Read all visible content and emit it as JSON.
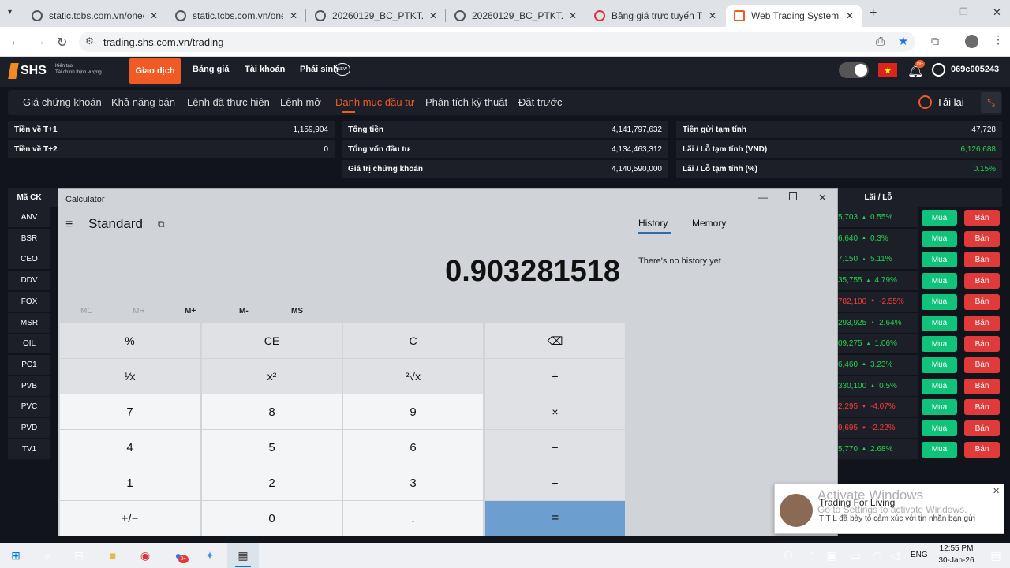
{
  "browser": {
    "tabs": [
      {
        "title": "static.tcbs.com.vn/oneclick"
      },
      {
        "title": "static.tcbs.com.vn/oneclick"
      },
      {
        "title": "20260129_BC_PTKT.pdf"
      },
      {
        "title": "20260129_BC_PTKT.pdf"
      },
      {
        "title": "Bảng giá trực tuyến TVSI"
      },
      {
        "title": "Web Trading System"
      }
    ],
    "url": "trading.shs.com.vn/trading"
  },
  "app": {
    "logo": "SHS",
    "logo_tagline_1": "Kiến tạo",
    "logo_tagline_2": "Tài chính thịnh vượng",
    "nav": [
      "Giao dịch",
      "Bảng giá",
      "Tài khoản",
      "Phái sinh"
    ],
    "new_badge": "NEW",
    "bell_badge": "99+",
    "username": "069c005243",
    "subnav": [
      "Giá chứng khoán",
      "Khả năng bán",
      "Lệnh đã thực hiện",
      "Lệnh mở",
      "Danh mục đầu tư",
      "Phân tích kỹ thuật",
      "Đặt trước"
    ],
    "reload_label": "Tải lại",
    "accent": "#f05a24"
  },
  "summary": {
    "col1": [
      {
        "label": "Tiền về T+1",
        "value": "1,159,904"
      },
      {
        "label": "Tiền về T+2",
        "value": "0"
      }
    ],
    "col2": [
      {
        "label": "Tổng tiền",
        "value": "4,141,797,632"
      },
      {
        "label": "Tổng vốn đầu tư",
        "value": "4,134,463,312"
      },
      {
        "label": "Giá trị chứng khoán",
        "value": "4,140,590,000"
      }
    ],
    "col3": [
      {
        "label": "Tiền gửi tạm tính",
        "value": "47,728"
      },
      {
        "label": "Lãi / Lỗ tạm tính (VND)",
        "value": "6,126,688"
      },
      {
        "label": "Lãi / Lỗ tạm tính (%)",
        "value": "0.15%"
      }
    ]
  },
  "table": {
    "header_code": "Mã CK",
    "header_pl": "Lãi / Lỗ",
    "buy_label": "Mua",
    "sell_label": "Bán",
    "rows": [
      {
        "code": "ANV",
        "pl": "5,703",
        "pct": "0.55%",
        "dir": "up"
      },
      {
        "code": "BSR",
        "pl": "6,640",
        "pct": "0.3%",
        "dir": "up"
      },
      {
        "code": "CEO",
        "pl": "7,150",
        "pct": "5.11%",
        "dir": "up"
      },
      {
        "code": "DDV",
        "pl": "35,755",
        "pct": "4.79%",
        "dir": "up"
      },
      {
        "code": "FOX",
        "pl": "782,100",
        "pct": "-2.55%",
        "dir": "down"
      },
      {
        "code": "MSR",
        "pl": "293,925",
        "pct": "2.64%",
        "dir": "up"
      },
      {
        "code": "OIL",
        "pl": "09,275",
        "pct": "1.06%",
        "dir": "up"
      },
      {
        "code": "PC1",
        "pl": "6,460",
        "pct": "3.23%",
        "dir": "up"
      },
      {
        "code": "PVB",
        "pl": "330,100",
        "pct": "0.5%",
        "dir": "up"
      },
      {
        "code": "PVC",
        "pl": "2,295",
        "pct": "-4.07%",
        "dir": "down"
      },
      {
        "code": "PVD",
        "pl": "9,695",
        "pct": "-2.22%",
        "dir": "down"
      },
      {
        "code": "TV1",
        "pl": "5,770",
        "pct": "2.68%",
        "dir": "up"
      }
    ]
  },
  "calculator": {
    "window_title": "Calculator",
    "mode": "Standard",
    "display": "0.903281518",
    "memory": [
      "MC",
      "MR",
      "M+",
      "M-",
      "MS"
    ],
    "keys": [
      "%",
      "CE",
      "C",
      "⌫",
      "¹⁄x",
      "x²",
      "²√x",
      "÷",
      "7",
      "8",
      "9",
      "×",
      "4",
      "5",
      "6",
      "−",
      "1",
      "2",
      "3",
      "+",
      "+/−",
      "0",
      ".",
      "="
    ],
    "history_tab": "History",
    "memory_tab": "Memory",
    "history_empty": "There's no history yet"
  },
  "notification": {
    "watermark_title": "Activate Windows",
    "watermark_sub": "Go to Settings to activate Windows.",
    "title": "Trading For Living",
    "message": "T T L đã bày tỏ cảm xúc với tin nhắn bạn gửi"
  },
  "taskbar": {
    "lang": "ENG",
    "time": "12:55 PM",
    "date": "30-Jan-26",
    "badge": "9+"
  }
}
